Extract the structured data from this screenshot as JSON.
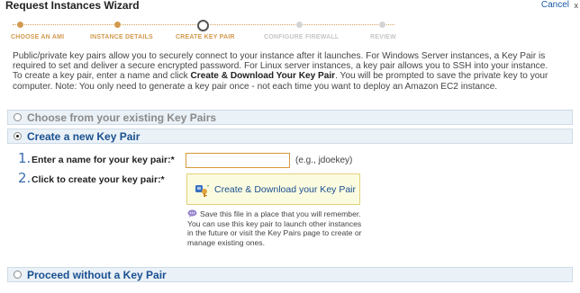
{
  "window": {
    "title": "Request Instances Wizard",
    "cancel_label": "Cancel",
    "close_glyph": "x"
  },
  "steps": [
    {
      "label": "CHOOSE AN AMI",
      "state": "done"
    },
    {
      "label": "INSTANCE DETAILS",
      "state": "done"
    },
    {
      "label": "CREATE KEY PAIR",
      "state": "current"
    },
    {
      "label": "CONFIGURE FIREWALL",
      "state": "future"
    },
    {
      "label": "REVIEW",
      "state": "future"
    }
  ],
  "intro": {
    "p1": "Public/private key pairs allow you to securely connect to your instance after it launches. For Windows Server instances, a Key Pair is required to set and deliver a secure encrypted password. For Linux server instances, a key pair allows you to SSH into your instance.",
    "p2_a": "To create a key pair, enter a name and click ",
    "p2_bold": "Create & Download Your Key Pair",
    "p2_b": ". You will be prompted to save the private key to your computer. Note: You only need to generate a key pair once - not each time you want to deploy an Amazon EC2 instance."
  },
  "options": {
    "existing_label": "Choose from your existing Key Pairs",
    "create_label": "Create a new Key Pair",
    "none_label": "Proceed without a Key Pair",
    "selected": "create"
  },
  "form": {
    "step1_num": "1.",
    "step1_label": "Enter a name for your key pair:*",
    "keyname_value": "",
    "keyname_hint": "(e.g., jdoekey)",
    "step2_num": "2.",
    "step2_label": "Click to create your key pair:*",
    "create_button_label": "Create & Download your Key Pair",
    "save_note": "Save this file in a place that you will remember. You can use this key pair to launch other instances in the future or visit the Key Pairs page to create or manage existing ones."
  },
  "colors": {
    "accent_orange": "#d29a4e",
    "link_blue": "#1a5090",
    "section_bg": "#eaf1f7",
    "button_bg": "#fbfbe0"
  }
}
